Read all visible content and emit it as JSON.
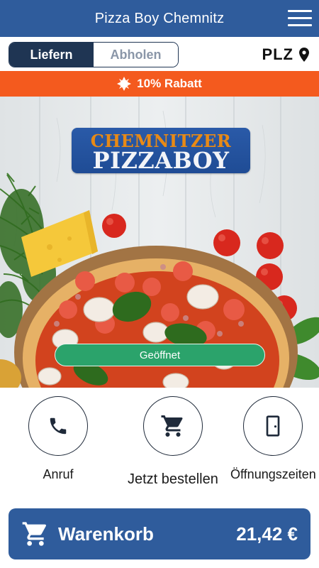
{
  "header": {
    "title": "Pizza Boy Chemnitz",
    "menu_icon": "hamburger-menu-icon"
  },
  "delivery_mode": {
    "options": [
      "Liefern",
      "Abholen"
    ],
    "selected": "Liefern"
  },
  "postcode": {
    "label": "PLZ",
    "icon": "location-pin-icon"
  },
  "promo": {
    "icon": "sun-badge-icon",
    "text": "10% Rabatt"
  },
  "hero": {
    "logo_line1": "CHEMNITZER",
    "logo_line2": "PIZZABOY",
    "status": "Geöffnet"
  },
  "actions": [
    {
      "label": "Anruf",
      "icon": "phone-icon"
    },
    {
      "label": "Jetzt bestellen",
      "icon": "shopping-cart-icon"
    },
    {
      "label": "Öffnungszeiten",
      "icon": "door-icon"
    }
  ],
  "cart": {
    "label": "Warenkorb",
    "total": "21,42 €",
    "icon": "shopping-cart-icon"
  },
  "colors": {
    "primary": "#2f5c9c",
    "dark": "#1f3553",
    "promo": "#f45a1e",
    "open": "#2ba36b"
  }
}
